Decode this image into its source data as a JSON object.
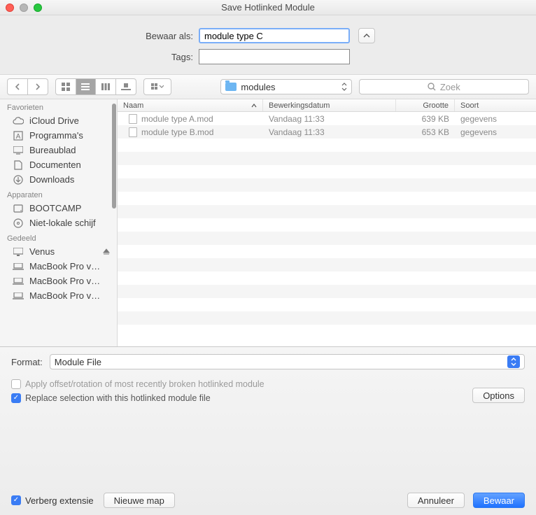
{
  "window": {
    "title": "Save Hotlinked Module"
  },
  "form": {
    "save_as_label": "Bewaar als:",
    "save_as_value": "module type C",
    "tags_label": "Tags:",
    "tags_value": ""
  },
  "toolbar": {
    "folder_name": "modules",
    "search_placeholder": "Zoek"
  },
  "sidebar": {
    "sections": [
      {
        "title": "Favorieten",
        "items": [
          {
            "label": "iCloud Drive",
            "icon": "cloud"
          },
          {
            "label": "Programma's",
            "icon": "apps"
          },
          {
            "label": "Bureaublad",
            "icon": "desktop"
          },
          {
            "label": "Documenten",
            "icon": "doc"
          },
          {
            "label": "Downloads",
            "icon": "download"
          }
        ]
      },
      {
        "title": "Apparaten",
        "items": [
          {
            "label": "BOOTCAMP",
            "icon": "hdd"
          },
          {
            "label": "Niet-lokale schijf",
            "icon": "disc"
          }
        ]
      },
      {
        "title": "Gedeeld",
        "items": [
          {
            "label": "Venus",
            "icon": "display",
            "eject": true
          },
          {
            "label": "MacBook Pro v…",
            "icon": "laptop"
          },
          {
            "label": "MacBook Pro v…",
            "icon": "laptop"
          },
          {
            "label": "MacBook Pro v…",
            "icon": "laptop"
          }
        ]
      }
    ]
  },
  "columns": {
    "name": "Naam",
    "date": "Bewerkingsdatum",
    "size": "Grootte",
    "kind": "Soort"
  },
  "files": [
    {
      "name": "module type A.mod",
      "date": "Vandaag 11:33",
      "size": "639 KB",
      "kind": "gegevens"
    },
    {
      "name": "module type B.mod",
      "date": "Vandaag 11:33",
      "size": "653 KB",
      "kind": "gegevens"
    }
  ],
  "format": {
    "label": "Format:",
    "value": "Module File"
  },
  "checks": {
    "offset_label": "Apply offset/rotation of most recently broken hotlinked module",
    "offset_checked": false,
    "replace_label": "Replace selection with this hotlinked module file",
    "replace_checked": true
  },
  "buttons": {
    "options": "Options",
    "hide_ext": "Verberg extensie",
    "hide_ext_checked": true,
    "new_folder": "Nieuwe map",
    "cancel": "Annuleer",
    "save": "Bewaar"
  }
}
